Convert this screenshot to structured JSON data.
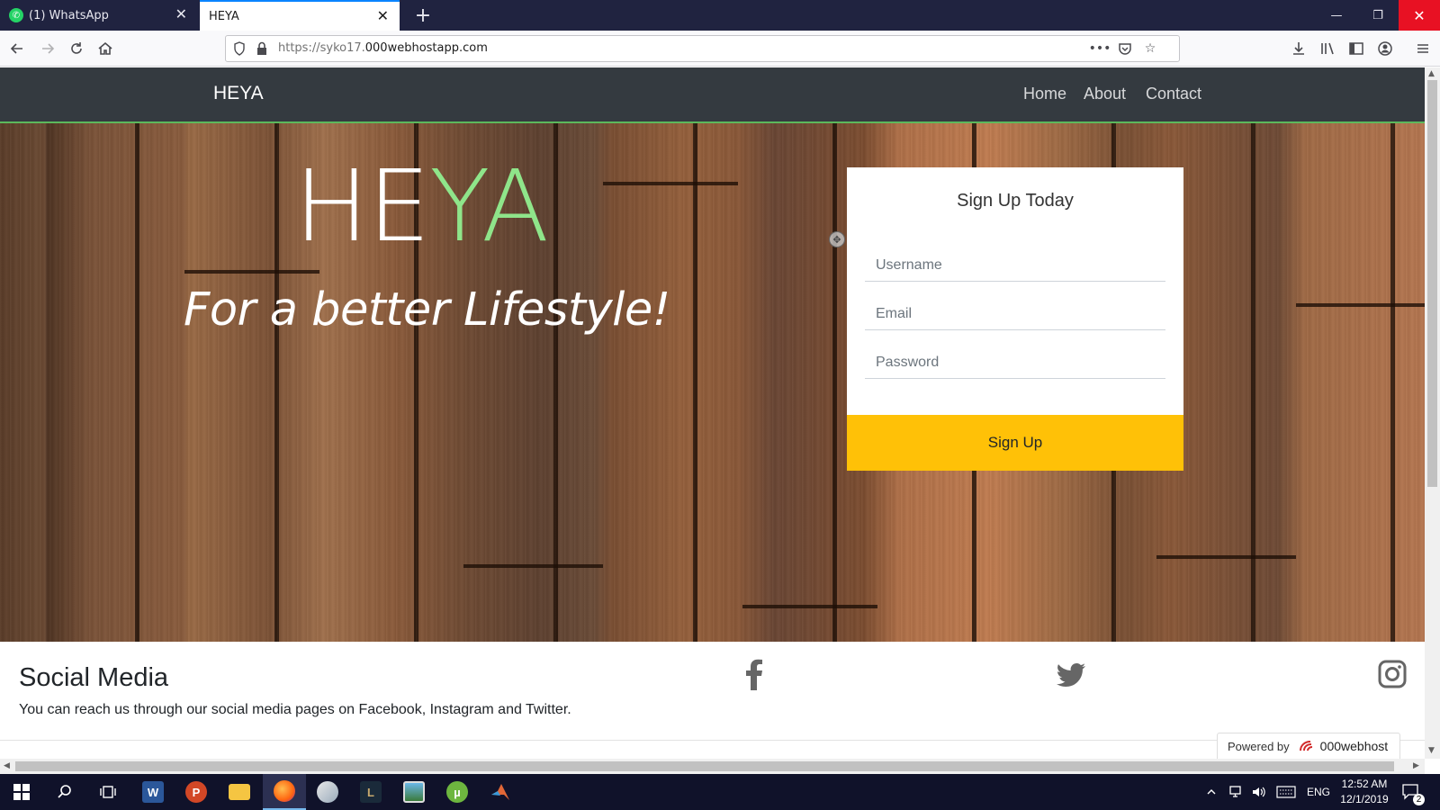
{
  "browser": {
    "tabs": [
      {
        "label": "(1) WhatsApp",
        "favicon": "whatsapp-icon",
        "active": false
      },
      {
        "label": "HEYA",
        "favicon": "",
        "active": true
      }
    ],
    "url_prefix": "https://syko17.",
    "url_domain": "000webhostapp.com",
    "window_controls": {
      "minimize": "—",
      "restore": "❐",
      "close": "✕"
    }
  },
  "site": {
    "brand": "HEYA",
    "nav": [
      "Home",
      "About",
      "Contact"
    ],
    "hero": {
      "title_white": "HE",
      "title_green": "YA",
      "subtitle": "For a better Lifestyle!"
    },
    "signup": {
      "title": "Sign Up Today",
      "username_placeholder": "Username",
      "email_placeholder": "Email",
      "password_placeholder": "Password",
      "button": "Sign Up"
    },
    "social": {
      "heading": "Social Media",
      "text": "You can reach us through our social media pages on Facebook, Instagram and Twitter.",
      "icons": [
        "facebook-icon",
        "twitter-icon",
        "instagram-icon"
      ]
    },
    "powered_by": {
      "label": "Powered by",
      "brand": "000webhost"
    }
  },
  "taskbar": {
    "apps": [
      "windows-start-icon",
      "search-icon",
      "task-view-icon",
      "word-icon",
      "powerpoint-icon",
      "file-explorer-icon",
      "firefox-icon",
      "paint-icon",
      "league-icon",
      "photos-icon",
      "utorrent-icon",
      "matlab-icon"
    ],
    "language": "ENG",
    "time": "12:52 AM",
    "date": "12/1/2019",
    "notifications": "2"
  },
  "colors": {
    "accent_green": "#8fe58a",
    "signup_button": "#ffc107",
    "navbar": "#343a40",
    "tabstrip": "#202340"
  }
}
